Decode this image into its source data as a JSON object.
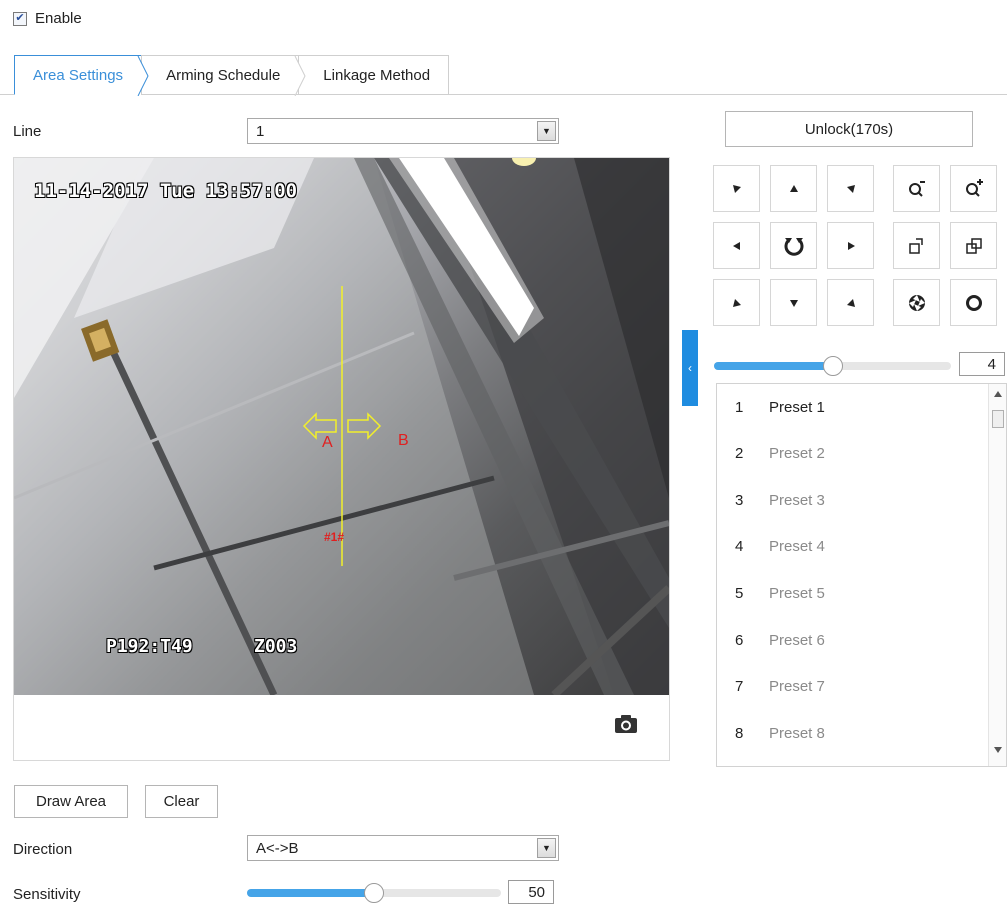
{
  "enable": {
    "label": "Enable",
    "checked": true
  },
  "tabs": [
    {
      "label": "Area Settings",
      "active": true
    },
    {
      "label": "Arming Schedule",
      "active": false
    },
    {
      "label": "Linkage Method",
      "active": false
    }
  ],
  "line": {
    "label": "Line",
    "value": "1"
  },
  "video": {
    "timestamp": "11-14-2017 Tue 13:57:00",
    "ptz_info_left": "P192:T49",
    "ptz_info_right": "Z003",
    "label_a": "A",
    "label_b": "B",
    "line_tag": "#1#"
  },
  "buttons": {
    "draw_area": "Draw Area",
    "clear": "Clear"
  },
  "direction": {
    "label": "Direction",
    "value": "A<->B"
  },
  "sensitivity": {
    "label": "Sensitivity",
    "value": "50",
    "level": 0.5
  },
  "ptz": {
    "unlock_label": "Unlock(170s)",
    "speed_value": "4",
    "speed_level": 0.5
  },
  "presets": [
    {
      "num": "1",
      "name": "Preset 1"
    },
    {
      "num": "2",
      "name": "Preset 2"
    },
    {
      "num": "3",
      "name": "Preset 3"
    },
    {
      "num": "4",
      "name": "Preset 4"
    },
    {
      "num": "5",
      "name": "Preset 5"
    },
    {
      "num": "6",
      "name": "Preset 6"
    },
    {
      "num": "7",
      "name": "Preset 7"
    },
    {
      "num": "8",
      "name": "Preset 8"
    }
  ],
  "colors": {
    "accent": "#3a8fd9",
    "slider": "#45a4e8",
    "line": "#f2ef2a",
    "marker": "#e02020"
  }
}
